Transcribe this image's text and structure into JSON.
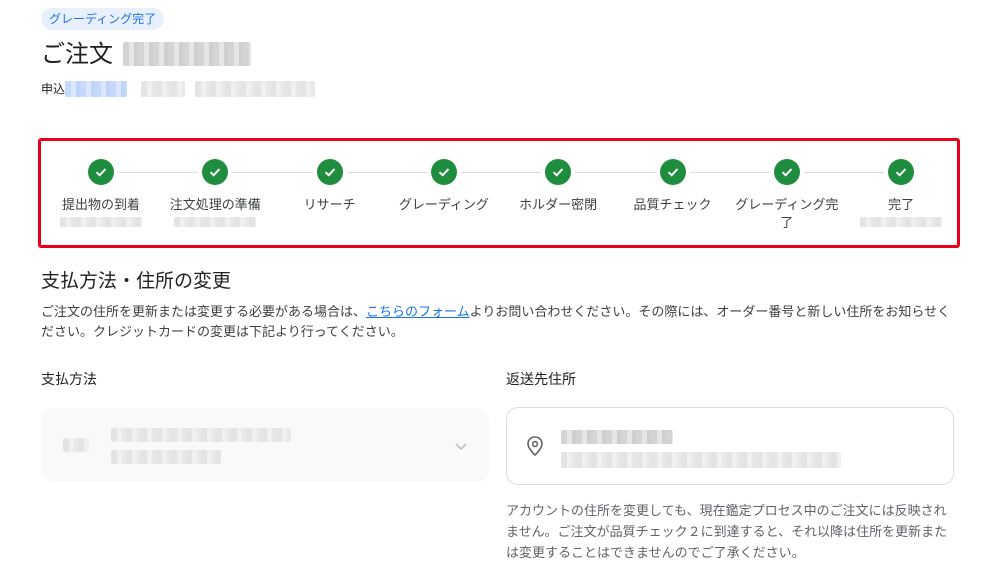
{
  "status_chip": "グレーディング完了",
  "order": {
    "title_prefix": "ご注文"
  },
  "applied": {
    "label": "申込"
  },
  "progress": {
    "steps": [
      {
        "label": "提出物の到着",
        "done": true
      },
      {
        "label": "注文処理の準備",
        "done": true
      },
      {
        "label": "リサーチ",
        "done": true
      },
      {
        "label": "グレーディング",
        "done": true
      },
      {
        "label": "ホルダー密閉",
        "done": true
      },
      {
        "label": "品質チェック",
        "done": true
      },
      {
        "label": "グレーディング完了",
        "done": true
      },
      {
        "label": "完了",
        "done": true
      }
    ],
    "check_color": "#1e8e3e",
    "highlight_color": "#e8001c"
  },
  "section": {
    "title": "支払方法・住所の変更",
    "desc_before": "ご注文の住所を更新または変更する必要がある場合は、",
    "desc_link": "こちらのフォーム",
    "desc_after": "よりお問い合わせください。その際には、オーダー番号と新しい住所をお知らせください。クレジットカードの変更は下記より行ってください。"
  },
  "payment": {
    "label": "支払方法"
  },
  "shipping": {
    "label": "返送先住所",
    "note": "アカウントの住所を変更しても、現在鑑定プロセス中のご注文には反映されません。ご注文が品質チェック２に到達すると、それ以降は住所を更新または変更することはできませんのでご了承ください。"
  },
  "icons": {
    "step": "check-icon",
    "address": "location-pin-icon",
    "dropdown": "chevron-down-icon"
  }
}
